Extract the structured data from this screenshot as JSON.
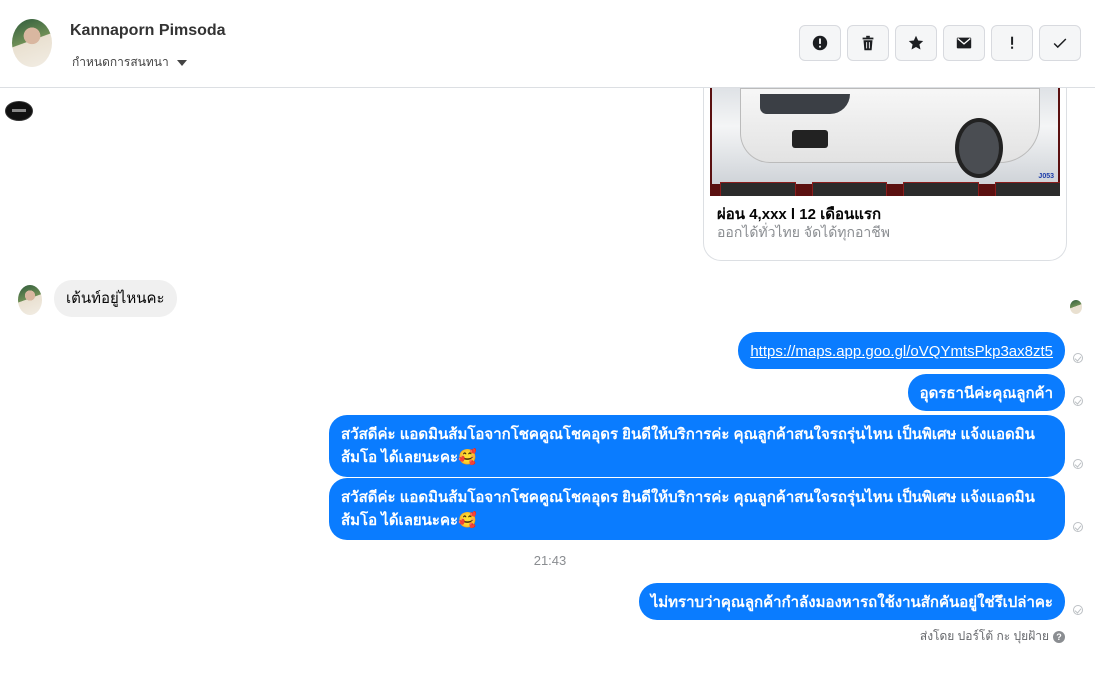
{
  "header": {
    "contact_name": "Kannaporn Pimsoda",
    "assign_label": "กำหนดการสนทนา"
  },
  "toolbar": {
    "buttons": [
      {
        "name": "spam-button",
        "icon": "alert-circle-icon"
      },
      {
        "name": "delete-button",
        "icon": "trash-icon"
      },
      {
        "name": "star-button",
        "icon": "star-icon"
      },
      {
        "name": "mark-unread-button",
        "icon": "envelope-icon"
      },
      {
        "name": "follow-up-button",
        "icon": "exclamation-icon"
      },
      {
        "name": "done-button",
        "icon": "check-icon"
      }
    ]
  },
  "card": {
    "title": "ผ่อน 4,xxx l 12 เดือนแรก",
    "description": "ออกได้ทั่วไทย จัดได้ทุกอาชีพ",
    "image_tag": "J053"
  },
  "messages": {
    "incoming_1": "เต้นท์อยู่ไหนคะ",
    "outgoing_link": "https://maps.app.goo.gl/oVQYmtsPkp3ax8zt5",
    "outgoing_2": "อุดรธานีค่ะคุณลูกค้า",
    "outgoing_3": "สวัสดีค่ะ แอดมินส้มโอจากโชคคูณโชคอุดร ยินดีให้บริการค่ะ   คุณลูกค้าสนใจรถรุ่นไหน เป็นพิเศษ แจ้งแอดมินส้มโอ ได้เลยนะคะ🥰",
    "outgoing_4": "สวัสดีค่ะ แอดมินส้มโอจากโชคคูณโชคอุดร ยินดีให้บริการค่ะ   คุณลูกค้าสนใจรถรุ่นไหน เป็นพิเศษ แจ้งแอดมินส้มโอ ได้เลยนะคะ🥰",
    "timestamp": "21:43",
    "outgoing_5": "ไม่ทราบว่าคุณลูกค้ากำลังมองหารถใช้งานสักคันอยู่ใช่รึเปล่าคะ",
    "sent_by": "ส่งโดย ปอร์โต้ กะ ปุยฝ้าย"
  },
  "colors": {
    "outgoing_bubble": "#0a7cff",
    "incoming_bubble": "#f0f0f0"
  }
}
